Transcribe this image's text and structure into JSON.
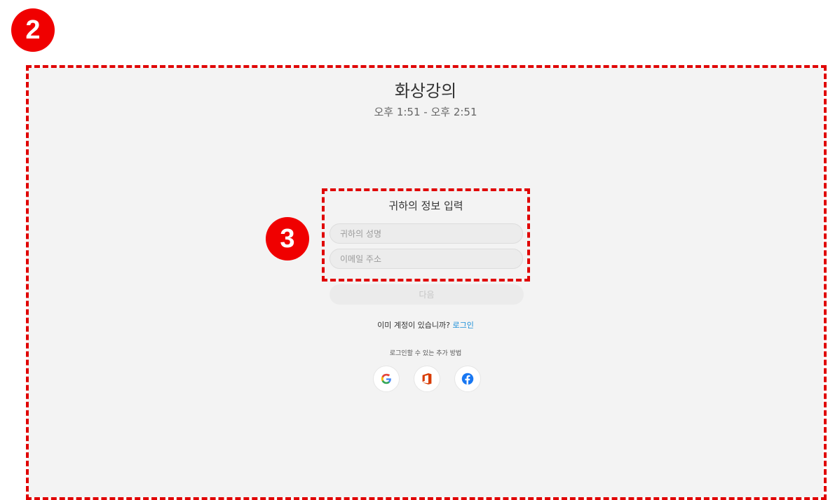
{
  "annotations": {
    "step_outer": "2",
    "step_inner": "3"
  },
  "header": {
    "title": "화상강의",
    "time_range": "오후 1:51 - 오후 2:51"
  },
  "form": {
    "heading": "귀하의 정보 입력",
    "name_placeholder": "귀하의 성명",
    "email_placeholder": "이메일 주소",
    "next_label": "다음"
  },
  "account": {
    "prompt": "이미 계정이 있습니까? ",
    "login_label": "로그인"
  },
  "alt_login": {
    "text": "로그인할 수 있는 추가 방법",
    "providers": [
      "google-icon",
      "office-icon",
      "facebook-icon"
    ]
  },
  "colors": {
    "annotation_red": "#e00000",
    "panel_bg": "#f3f3f3",
    "link_blue": "#1a8fd8"
  }
}
